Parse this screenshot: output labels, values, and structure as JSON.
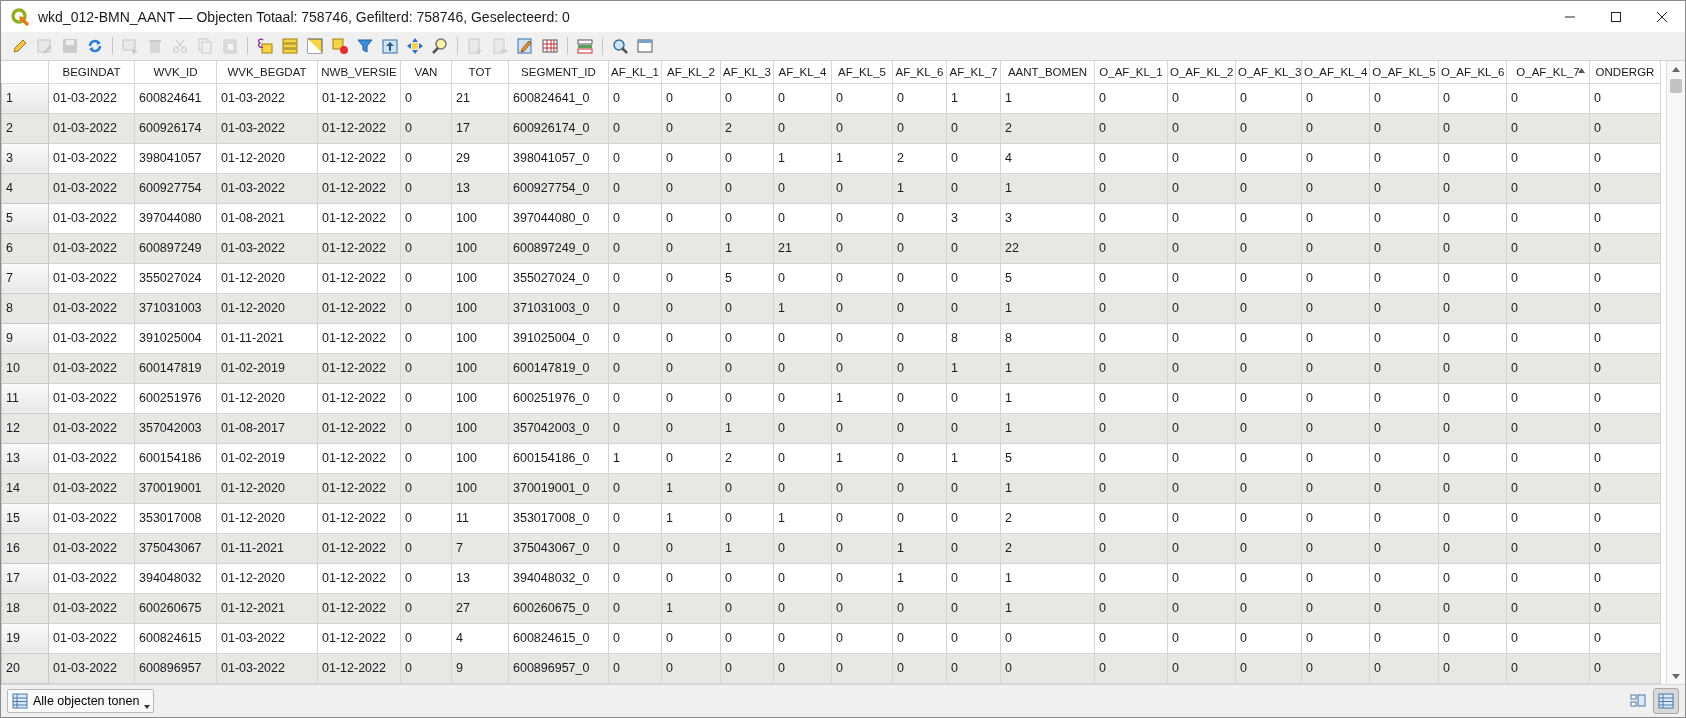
{
  "window": {
    "title": "wkd_012-BMN_AANT — Objecten Totaal: 758746, Gefilterd: 758746, Geselecteerd: 0"
  },
  "toolbar": [
    [
      {
        "disabled": false
      },
      {
        "disabled": true
      },
      {
        "disabled": true
      },
      {
        "disabled": false
      }
    ],
    [
      {
        "disabled": true
      },
      {
        "disabled": true
      },
      {
        "disabled": true
      },
      {
        "disabled": true
      },
      {
        "disabled": true
      }
    ],
    [
      {
        "disabled": false
      },
      {
        "disabled": false
      },
      {
        "disabled": false
      },
      {
        "disabled": false
      },
      {
        "disabled": false
      },
      {
        "disabled": false
      },
      {
        "disabled": false
      },
      {
        "disabled": false
      }
    ],
    [
      {
        "disabled": true
      },
      {
        "disabled": true
      },
      {
        "disabled": false
      },
      {
        "disabled": false
      }
    ],
    [
      {
        "disabled": false
      }
    ],
    [
      {
        "disabled": false
      },
      {
        "disabled": false
      }
    ]
  ],
  "table": {
    "columns": [
      {
        "label": "BEGINDAT",
        "sorted": false
      },
      {
        "label": "WVK_ID",
        "sorted": false
      },
      {
        "label": "WVK_BEGDAT",
        "sorted": false
      },
      {
        "label": "NWB_VERSIE",
        "sorted": false
      },
      {
        "label": "VAN",
        "sorted": false
      },
      {
        "label": "TOT",
        "sorted": false
      },
      {
        "label": "SEGMENT_ID",
        "sorted": false
      },
      {
        "label": "AF_KL_1",
        "sorted": false
      },
      {
        "label": "AF_KL_2",
        "sorted": false
      },
      {
        "label": "AF_KL_3",
        "sorted": false
      },
      {
        "label": "AF_KL_4",
        "sorted": false
      },
      {
        "label": "AF_KL_5",
        "sorted": false
      },
      {
        "label": "AF_KL_6",
        "sorted": false
      },
      {
        "label": "AF_KL_7",
        "sorted": false
      },
      {
        "label": "AANT_BOMEN",
        "sorted": false
      },
      {
        "label": "O_AF_KL_1",
        "sorted": false
      },
      {
        "label": "O_AF_KL_2",
        "sorted": false
      },
      {
        "label": "O_AF_KL_3",
        "sorted": false
      },
      {
        "label": "O_AF_KL_4",
        "sorted": false
      },
      {
        "label": "O_AF_KL_5",
        "sorted": false
      },
      {
        "label": "O_AF_KL_6",
        "sorted": false
      },
      {
        "label": "O_AF_KL_7",
        "sorted": true
      },
      {
        "label": "ONDERGR",
        "sorted": false
      }
    ],
    "rows": [
      {
        "number": "1",
        "cells": [
          "01-03-2022",
          "600824641",
          "01-03-2022",
          "01-12-2022",
          "0",
          "21",
          "600824641_0",
          "0",
          "0",
          "0",
          "0",
          "0",
          "0",
          "1",
          "1",
          "0",
          "0",
          "0",
          "0",
          "0",
          "0",
          "0",
          "0"
        ]
      },
      {
        "number": "2",
        "cells": [
          "01-03-2022",
          "600926174",
          "01-03-2022",
          "01-12-2022",
          "0",
          "17",
          "600926174_0",
          "0",
          "0",
          "2",
          "0",
          "0",
          "0",
          "0",
          "2",
          "0",
          "0",
          "0",
          "0",
          "0",
          "0",
          "0",
          "0"
        ]
      },
      {
        "number": "3",
        "cells": [
          "01-03-2022",
          "398041057",
          "01-12-2020",
          "01-12-2022",
          "0",
          "29",
          "398041057_0",
          "0",
          "0",
          "0",
          "1",
          "1",
          "2",
          "0",
          "4",
          "0",
          "0",
          "0",
          "0",
          "0",
          "0",
          "0",
          "0"
        ]
      },
      {
        "number": "4",
        "cells": [
          "01-03-2022",
          "600927754",
          "01-03-2022",
          "01-12-2022",
          "0",
          "13",
          "600927754_0",
          "0",
          "0",
          "0",
          "0",
          "0",
          "1",
          "0",
          "1",
          "0",
          "0",
          "0",
          "0",
          "0",
          "0",
          "0",
          "0"
        ]
      },
      {
        "number": "5",
        "cells": [
          "01-03-2022",
          "397044080",
          "01-08-2021",
          "01-12-2022",
          "0",
          "100",
          "397044080_0",
          "0",
          "0",
          "0",
          "0",
          "0",
          "0",
          "3",
          "3",
          "0",
          "0",
          "0",
          "0",
          "0",
          "0",
          "0",
          "0"
        ]
      },
      {
        "number": "6",
        "cells": [
          "01-03-2022",
          "600897249",
          "01-03-2022",
          "01-12-2022",
          "0",
          "100",
          "600897249_0",
          "0",
          "0",
          "1",
          "21",
          "0",
          "0",
          "0",
          "22",
          "0",
          "0",
          "0",
          "0",
          "0",
          "0",
          "0",
          "0"
        ]
      },
      {
        "number": "7",
        "cells": [
          "01-03-2022",
          "355027024",
          "01-12-2020",
          "01-12-2022",
          "0",
          "100",
          "355027024_0",
          "0",
          "0",
          "5",
          "0",
          "0",
          "0",
          "0",
          "5",
          "0",
          "0",
          "0",
          "0",
          "0",
          "0",
          "0",
          "0"
        ]
      },
      {
        "number": "8",
        "cells": [
          "01-03-2022",
          "371031003",
          "01-12-2020",
          "01-12-2022",
          "0",
          "100",
          "371031003_0",
          "0",
          "0",
          "0",
          "1",
          "0",
          "0",
          "0",
          "1",
          "0",
          "0",
          "0",
          "0",
          "0",
          "0",
          "0",
          "0"
        ]
      },
      {
        "number": "9",
        "cells": [
          "01-03-2022",
          "391025004",
          "01-11-2021",
          "01-12-2022",
          "0",
          "100",
          "391025004_0",
          "0",
          "0",
          "0",
          "0",
          "0",
          "0",
          "8",
          "8",
          "0",
          "0",
          "0",
          "0",
          "0",
          "0",
          "0",
          "0"
        ]
      },
      {
        "number": "10",
        "cells": [
          "01-03-2022",
          "600147819",
          "01-02-2019",
          "01-12-2022",
          "0",
          "100",
          "600147819_0",
          "0",
          "0",
          "0",
          "0",
          "0",
          "0",
          "1",
          "1",
          "0",
          "0",
          "0",
          "0",
          "0",
          "0",
          "0",
          "0"
        ]
      },
      {
        "number": "11",
        "cells": [
          "01-03-2022",
          "600251976",
          "01-12-2020",
          "01-12-2022",
          "0",
          "100",
          "600251976_0",
          "0",
          "0",
          "0",
          "0",
          "1",
          "0",
          "0",
          "1",
          "0",
          "0",
          "0",
          "0",
          "0",
          "0",
          "0",
          "0"
        ]
      },
      {
        "number": "12",
        "cells": [
          "01-03-2022",
          "357042003",
          "01-08-2017",
          "01-12-2022",
          "0",
          "100",
          "357042003_0",
          "0",
          "0",
          "1",
          "0",
          "0",
          "0",
          "0",
          "1",
          "0",
          "0",
          "0",
          "0",
          "0",
          "0",
          "0",
          "0"
        ]
      },
      {
        "number": "13",
        "cells": [
          "01-03-2022",
          "600154186",
          "01-02-2019",
          "01-12-2022",
          "0",
          "100",
          "600154186_0",
          "1",
          "0",
          "2",
          "0",
          "1",
          "0",
          "1",
          "5",
          "0",
          "0",
          "0",
          "0",
          "0",
          "0",
          "0",
          "0"
        ]
      },
      {
        "number": "14",
        "cells": [
          "01-03-2022",
          "370019001",
          "01-12-2020",
          "01-12-2022",
          "0",
          "100",
          "370019001_0",
          "0",
          "1",
          "0",
          "0",
          "0",
          "0",
          "0",
          "1",
          "0",
          "0",
          "0",
          "0",
          "0",
          "0",
          "0",
          "0"
        ]
      },
      {
        "number": "15",
        "cells": [
          "01-03-2022",
          "353017008",
          "01-12-2020",
          "01-12-2022",
          "0",
          "11",
          "353017008_0",
          "0",
          "1",
          "0",
          "1",
          "0",
          "0",
          "0",
          "2",
          "0",
          "0",
          "0",
          "0",
          "0",
          "0",
          "0",
          "0"
        ]
      },
      {
        "number": "16",
        "cells": [
          "01-03-2022",
          "375043067",
          "01-11-2021",
          "01-12-2022",
          "0",
          "7",
          "375043067_0",
          "0",
          "0",
          "1",
          "0",
          "0",
          "1",
          "0",
          "2",
          "0",
          "0",
          "0",
          "0",
          "0",
          "0",
          "0",
          "0"
        ]
      },
      {
        "number": "17",
        "cells": [
          "01-03-2022",
          "394048032",
          "01-12-2020",
          "01-12-2022",
          "0",
          "13",
          "394048032_0",
          "0",
          "0",
          "0",
          "0",
          "0",
          "1",
          "0",
          "1",
          "0",
          "0",
          "0",
          "0",
          "0",
          "0",
          "0",
          "0"
        ]
      },
      {
        "number": "18",
        "cells": [
          "01-03-2022",
          "600260675",
          "01-12-2021",
          "01-12-2022",
          "0",
          "27",
          "600260675_0",
          "0",
          "1",
          "0",
          "0",
          "0",
          "0",
          "0",
          "1",
          "0",
          "0",
          "0",
          "0",
          "0",
          "0",
          "0",
          "0"
        ]
      },
      {
        "number": "19",
        "cells": [
          "01-03-2022",
          "600824615",
          "01-03-2022",
          "01-12-2022",
          "0",
          "4",
          "600824615_0",
          "0",
          "0",
          "0",
          "0",
          "0",
          "0",
          "0",
          "0",
          "0",
          "0",
          "0",
          "0",
          "0",
          "0",
          "0",
          "0"
        ]
      },
      {
        "number": "20",
        "cells": [
          "01-03-2022",
          "600896957",
          "01-03-2022",
          "01-12-2022",
          "0",
          "9",
          "600896957_0",
          "0",
          "0",
          "0",
          "0",
          "0",
          "0",
          "0",
          "0",
          "0",
          "0",
          "0",
          "0",
          "0",
          "0",
          "0",
          "0"
        ]
      }
    ]
  },
  "bottom_bar": {
    "filter_button": {
      "label": "Alle objecten tonen"
    },
    "views": [
      {
        "selected": false
      },
      {
        "selected": true
      }
    ]
  }
}
